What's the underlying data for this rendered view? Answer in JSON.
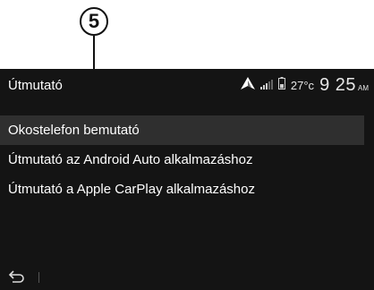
{
  "callout": {
    "number": "5"
  },
  "header": {
    "title": "Útmutató",
    "temperature": "27°c",
    "time": "9 25",
    "ampm": "AM"
  },
  "menu": {
    "items": [
      {
        "label": "Okostelefon bemutató",
        "selected": true
      },
      {
        "label": "Útmutató az Android Auto alkalmazáshoz",
        "selected": false
      },
      {
        "label": "Útmutató a Apple CarPlay alkalmazáshoz",
        "selected": false
      }
    ]
  },
  "colors": {
    "screen_bg": "#141414",
    "selected_bg": "#2f2f2f",
    "text": "#ffffff"
  },
  "icons": {
    "navigation": "navigation-arrow-icon",
    "signal": "signal-bars-icon",
    "battery": "battery-icon",
    "back": "back-arrow-icon"
  }
}
